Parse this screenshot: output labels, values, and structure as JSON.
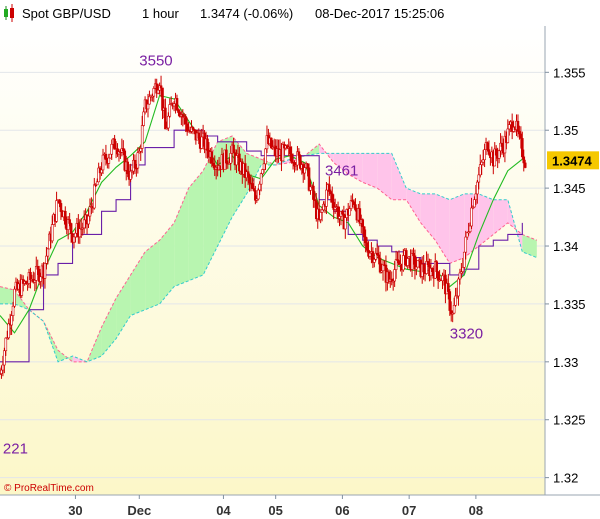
{
  "header": {
    "title": "Spot GBP/USD",
    "timeframe": "1 hour",
    "price_change": "1.3474 (-0.06%)",
    "datetime": "08-Dec-2017 15:25:06"
  },
  "watermark": "© ProRealTime.com",
  "price_badge": "1.3474",
  "annotations": [
    {
      "text": "3550",
      "x": 48,
      "y": 1.3556
    },
    {
      "text": "3461",
      "x": 112,
      "y": 1.3461
    },
    {
      "text": "3320",
      "x": 155,
      "y": 1.332
    },
    {
      "text": "221",
      "x": 1,
      "y": 1.3221
    }
  ],
  "colors": {
    "bg_top": "#ffffff",
    "bg_bottom": "#fcf8cc",
    "candle": "#cc0000",
    "kijun": "#6a1fa8",
    "tenkan": "#22bb22",
    "cloud_bear": "#ffc4ea",
    "cloud_bull": "#b8f5b0",
    "span_a": "#ff6090",
    "span_b": "#33cccc",
    "badge_bg": "#f5c800"
  },
  "chart_data": {
    "type": "candlestick",
    "y_axis": {
      "ylim": [
        1.3185,
        1.359
      ],
      "ticks": [
        "1.355",
        "1.35",
        "1.345",
        "1.34",
        "1.335",
        "1.33",
        "1.325",
        "1.32"
      ],
      "position": "right"
    },
    "x_axis": {
      "ticks": [
        {
          "label": "30",
          "x": 26
        },
        {
          "label": "Dec",
          "x": 48
        },
        {
          "label": "04",
          "x": 77
        },
        {
          "label": "05",
          "x": 95
        },
        {
          "label": "06",
          "x": 118
        },
        {
          "label": "07",
          "x": 141
        },
        {
          "label": "08",
          "x": 164
        }
      ]
    },
    "price": {
      "x": [
        0,
        5,
        10,
        15,
        20,
        25,
        30,
        35,
        40,
        45,
        48,
        50,
        55,
        57,
        60,
        65,
        70,
        75,
        80,
        85,
        88,
        92,
        95,
        100,
        105,
        110,
        113,
        118,
        122,
        126,
        130,
        134,
        136,
        140,
        145,
        150,
        153,
        156,
        158,
        161,
        163,
        166,
        168,
        170,
        174,
        177,
        179,
        181
      ],
      "y": [
        1.329,
        1.336,
        1.337,
        1.338,
        1.344,
        1.341,
        1.342,
        1.347,
        1.349,
        1.346,
        1.348,
        1.352,
        1.3545,
        1.35,
        1.353,
        1.35,
        1.349,
        1.347,
        1.348,
        1.346,
        1.344,
        1.349,
        1.348,
        1.348,
        1.347,
        1.342,
        1.345,
        1.342,
        1.344,
        1.34,
        1.339,
        1.337,
        1.338,
        1.339,
        1.338,
        1.338,
        1.337,
        1.334,
        1.3365,
        1.341,
        1.344,
        1.347,
        1.349,
        1.3475,
        1.349,
        1.351,
        1.349,
        1.3474
      ]
    },
    "tenkan": {
      "x": [
        0,
        5,
        10,
        15,
        20,
        25,
        30,
        35,
        40,
        45,
        50,
        55,
        60,
        65,
        70,
        75,
        80,
        85,
        90,
        95,
        100,
        105,
        110,
        115,
        120,
        125,
        130,
        135,
        140,
        145,
        150,
        155,
        160,
        165,
        170,
        175,
        180
      ],
      "y": [
        1.334,
        1.3325,
        1.3345,
        1.3378,
        1.3405,
        1.3412,
        1.343,
        1.3455,
        1.3468,
        1.3478,
        1.349,
        1.353,
        1.3527,
        1.3508,
        1.349,
        1.347,
        1.3478,
        1.3462,
        1.3458,
        1.3475,
        1.3478,
        1.3472,
        1.3435,
        1.3425,
        1.342,
        1.34,
        1.339,
        1.3385,
        1.338,
        1.3378,
        1.338,
        1.3365,
        1.3375,
        1.341,
        1.344,
        1.3465,
        1.3475
      ]
    },
    "kijun": {
      "x": [
        0,
        5,
        10,
        15,
        20,
        25,
        30,
        35,
        40,
        45,
        50,
        55,
        60,
        65,
        70,
        75,
        80,
        85,
        90,
        95,
        100,
        105,
        110,
        115,
        120,
        125,
        130,
        135,
        140,
        145,
        150,
        155,
        160,
        165,
        170,
        175,
        180
      ],
      "y": [
        1.33,
        1.33,
        1.3345,
        1.3375,
        1.3385,
        1.341,
        1.341,
        1.343,
        1.344,
        1.347,
        1.3485,
        1.3485,
        1.35,
        1.35,
        1.3495,
        1.349,
        1.349,
        1.3482,
        1.3478,
        1.3478,
        1.3478,
        1.3478,
        1.344,
        1.343,
        1.341,
        1.3405,
        1.34,
        1.3395,
        1.339,
        1.3385,
        1.3385,
        1.3375,
        1.338,
        1.34,
        1.3405,
        1.341,
        1.342
      ]
    },
    "span_a": {
      "x": [
        0,
        5,
        10,
        15,
        20,
        25,
        30,
        35,
        40,
        45,
        50,
        55,
        60,
        65,
        70,
        75,
        80,
        85,
        90,
        95,
        100,
        105,
        110,
        115,
        120,
        125,
        130,
        135,
        140,
        145,
        150,
        155,
        160,
        165,
        170,
        175,
        180,
        185
      ],
      "y": [
        1.3365,
        1.3362,
        1.3345,
        1.3335,
        1.331,
        1.33,
        1.33,
        1.333,
        1.3355,
        1.3375,
        1.3395,
        1.3405,
        1.342,
        1.345,
        1.3465,
        1.349,
        1.3495,
        1.348,
        1.3475,
        1.347,
        1.3472,
        1.3478,
        1.3488,
        1.3472,
        1.3462,
        1.3455,
        1.345,
        1.344,
        1.344,
        1.342,
        1.3405,
        1.3385,
        1.339,
        1.34,
        1.341,
        1.342,
        1.341,
        1.3405
      ]
    },
    "span_b": {
      "x": [
        0,
        5,
        10,
        15,
        20,
        25,
        30,
        35,
        40,
        45,
        50,
        55,
        60,
        65,
        70,
        75,
        80,
        85,
        90,
        95,
        100,
        105,
        110,
        115,
        120,
        125,
        130,
        135,
        140,
        145,
        150,
        155,
        160,
        165,
        170,
        175,
        180,
        185
      ],
      "y": [
        1.335,
        1.335,
        1.3345,
        1.3335,
        1.33,
        1.3305,
        1.33,
        1.3305,
        1.332,
        1.334,
        1.3345,
        1.335,
        1.3365,
        1.337,
        1.3375,
        1.34,
        1.3425,
        1.3445,
        1.347,
        1.347,
        1.3475,
        1.3478,
        1.348,
        1.348,
        1.348,
        1.348,
        1.348,
        1.348,
        1.345,
        1.3445,
        1.3445,
        1.344,
        1.3445,
        1.3445,
        1.344,
        1.344,
        1.3395,
        1.339
      ]
    },
    "x_range": [
      0,
      185
    ]
  }
}
